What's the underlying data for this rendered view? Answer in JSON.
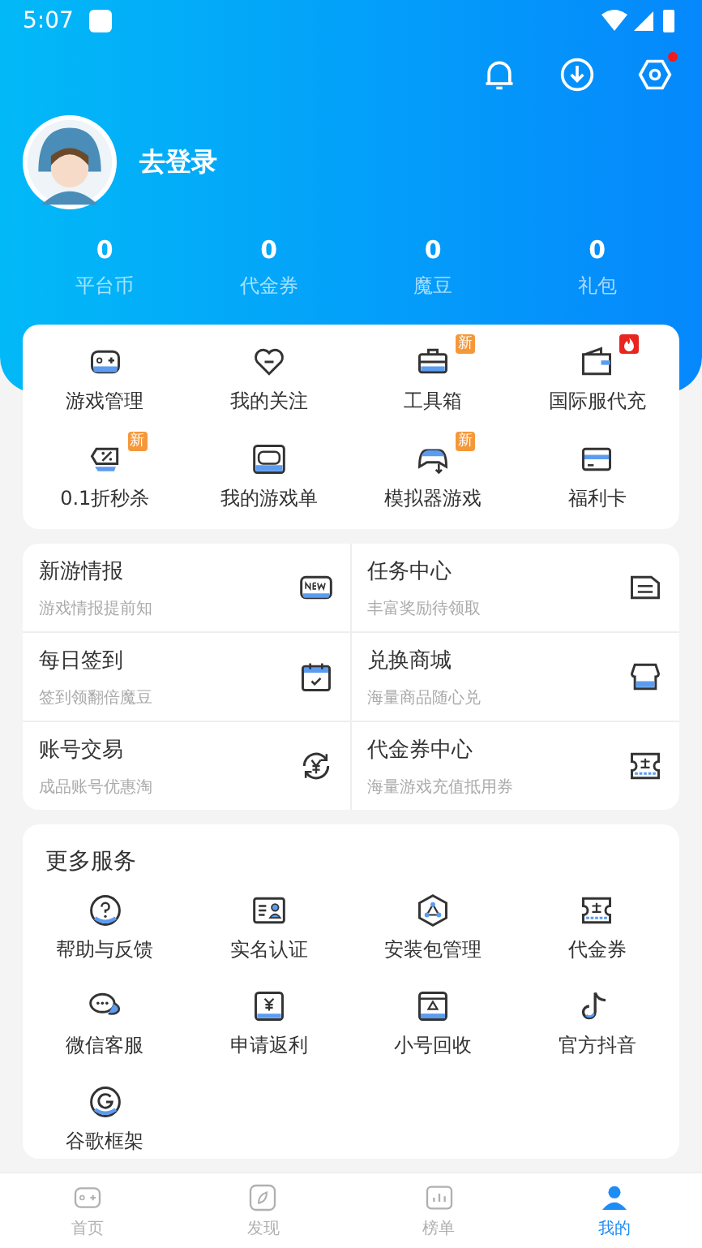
{
  "status_bar": {
    "time": "5:07"
  },
  "header": {
    "notification_dot": true,
    "login_label": "去登录"
  },
  "stats": [
    {
      "value": "0",
      "label": "平台币"
    },
    {
      "value": "0",
      "label": "代金券"
    },
    {
      "value": "0",
      "label": "魔豆"
    },
    {
      "value": "0",
      "label": "礼包"
    }
  ],
  "quick_menu": [
    {
      "label": "游戏管理",
      "kind": "gamepad"
    },
    {
      "label": "我的关注",
      "kind": "heart"
    },
    {
      "label": "工具箱",
      "kind": "toolbox",
      "badge": {
        "kind": "new",
        "text": "新"
      }
    },
    {
      "label": "国际服代充",
      "kind": "wallet",
      "badge": {
        "kind": "hot"
      }
    },
    {
      "label": "0.1折秒杀",
      "kind": "discount",
      "badge": {
        "kind": "new",
        "text": "新"
      }
    },
    {
      "label": "我的游戏单",
      "kind": "console"
    },
    {
      "label": "模拟器游戏",
      "kind": "controller",
      "badge": {
        "kind": "new",
        "text": "新"
      }
    },
    {
      "label": "福利卡",
      "kind": "card"
    }
  ],
  "features": [
    {
      "title": "新游情报",
      "subtitle": "游戏情报提前知",
      "kind": "new"
    },
    {
      "title": "任务中心",
      "subtitle": "丰富奖励待领取",
      "kind": "doc"
    },
    {
      "title": "每日签到",
      "subtitle": "签到领翻倍魔豆",
      "kind": "calendar"
    },
    {
      "title": "兑换商城",
      "subtitle": "海量商品随心兑",
      "kind": "shop"
    },
    {
      "title": "账号交易",
      "subtitle": "成品账号优惠淘",
      "kind": "exchange"
    },
    {
      "title": "代金券中心",
      "subtitle": "海量游戏充值抵用券",
      "kind": "ticket"
    }
  ],
  "more_services": {
    "title": "更多服务",
    "items": [
      {
        "label": "帮助与反馈",
        "kind": "help"
      },
      {
        "label": "实名认证",
        "kind": "idcard"
      },
      {
        "label": "安装包管理",
        "kind": "package"
      },
      {
        "label": "代金券",
        "kind": "ticket"
      },
      {
        "label": "微信客服",
        "kind": "chat"
      },
      {
        "label": "申请返利",
        "kind": "rebate"
      },
      {
        "label": "小号回收",
        "kind": "recycle"
      },
      {
        "label": "官方抖音",
        "kind": "note"
      },
      {
        "label": "谷歌框架",
        "kind": "g"
      }
    ]
  },
  "bottom_nav": [
    {
      "label": "首页",
      "kind": "gamepad",
      "selected": false
    },
    {
      "label": "发现",
      "kind": "compass",
      "selected": false
    },
    {
      "label": "榜单",
      "kind": "rank",
      "selected": false
    },
    {
      "label": "我的",
      "kind": "person",
      "selected": true
    }
  ]
}
